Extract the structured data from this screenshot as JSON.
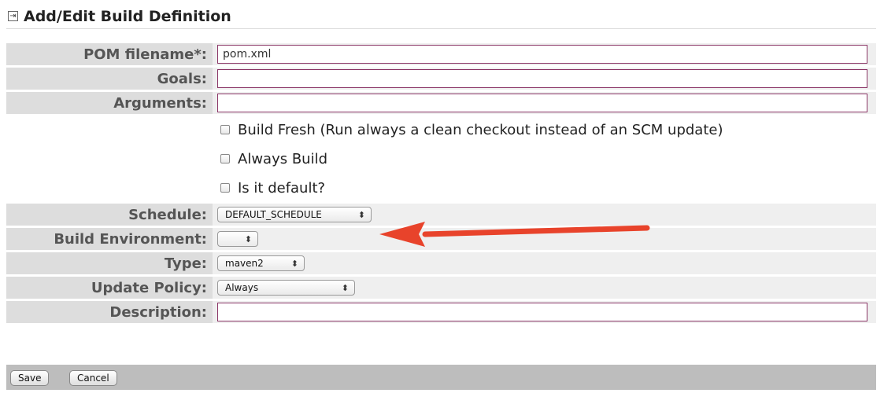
{
  "header": {
    "title": "Add/Edit Build Definition",
    "icon": "collapse-icon"
  },
  "fields": {
    "pom": {
      "label": "POM filename*:",
      "value": "pom.xml"
    },
    "goals": {
      "label": "Goals:",
      "value": ""
    },
    "arguments": {
      "label": "Arguments:",
      "value": ""
    }
  },
  "checkboxes": [
    {
      "label": "Build Fresh (Run always a clean checkout instead of an SCM update)",
      "checked": false
    },
    {
      "label": "Always Build",
      "checked": false
    },
    {
      "label": "Is it default?",
      "checked": false
    }
  ],
  "selects": {
    "schedule": {
      "label": "Schedule:",
      "value": "DEFAULT_SCHEDULE"
    },
    "build_environment": {
      "label": "Build Environment:",
      "value": ""
    },
    "type": {
      "label": "Type:",
      "value": "maven2"
    },
    "update_policy": {
      "label": "Update Policy:",
      "value": "Always"
    }
  },
  "description": {
    "label": "Description:",
    "value": ""
  },
  "footer": {
    "save_label": "Save",
    "cancel_label": "Cancel"
  },
  "annotation": {
    "arrow_color": "#e8432b"
  },
  "colors": {
    "input_border": "#8a3566",
    "label_bg": "#dddddd",
    "field_bg": "#efefef",
    "footer_bg": "#bdbdbd"
  }
}
